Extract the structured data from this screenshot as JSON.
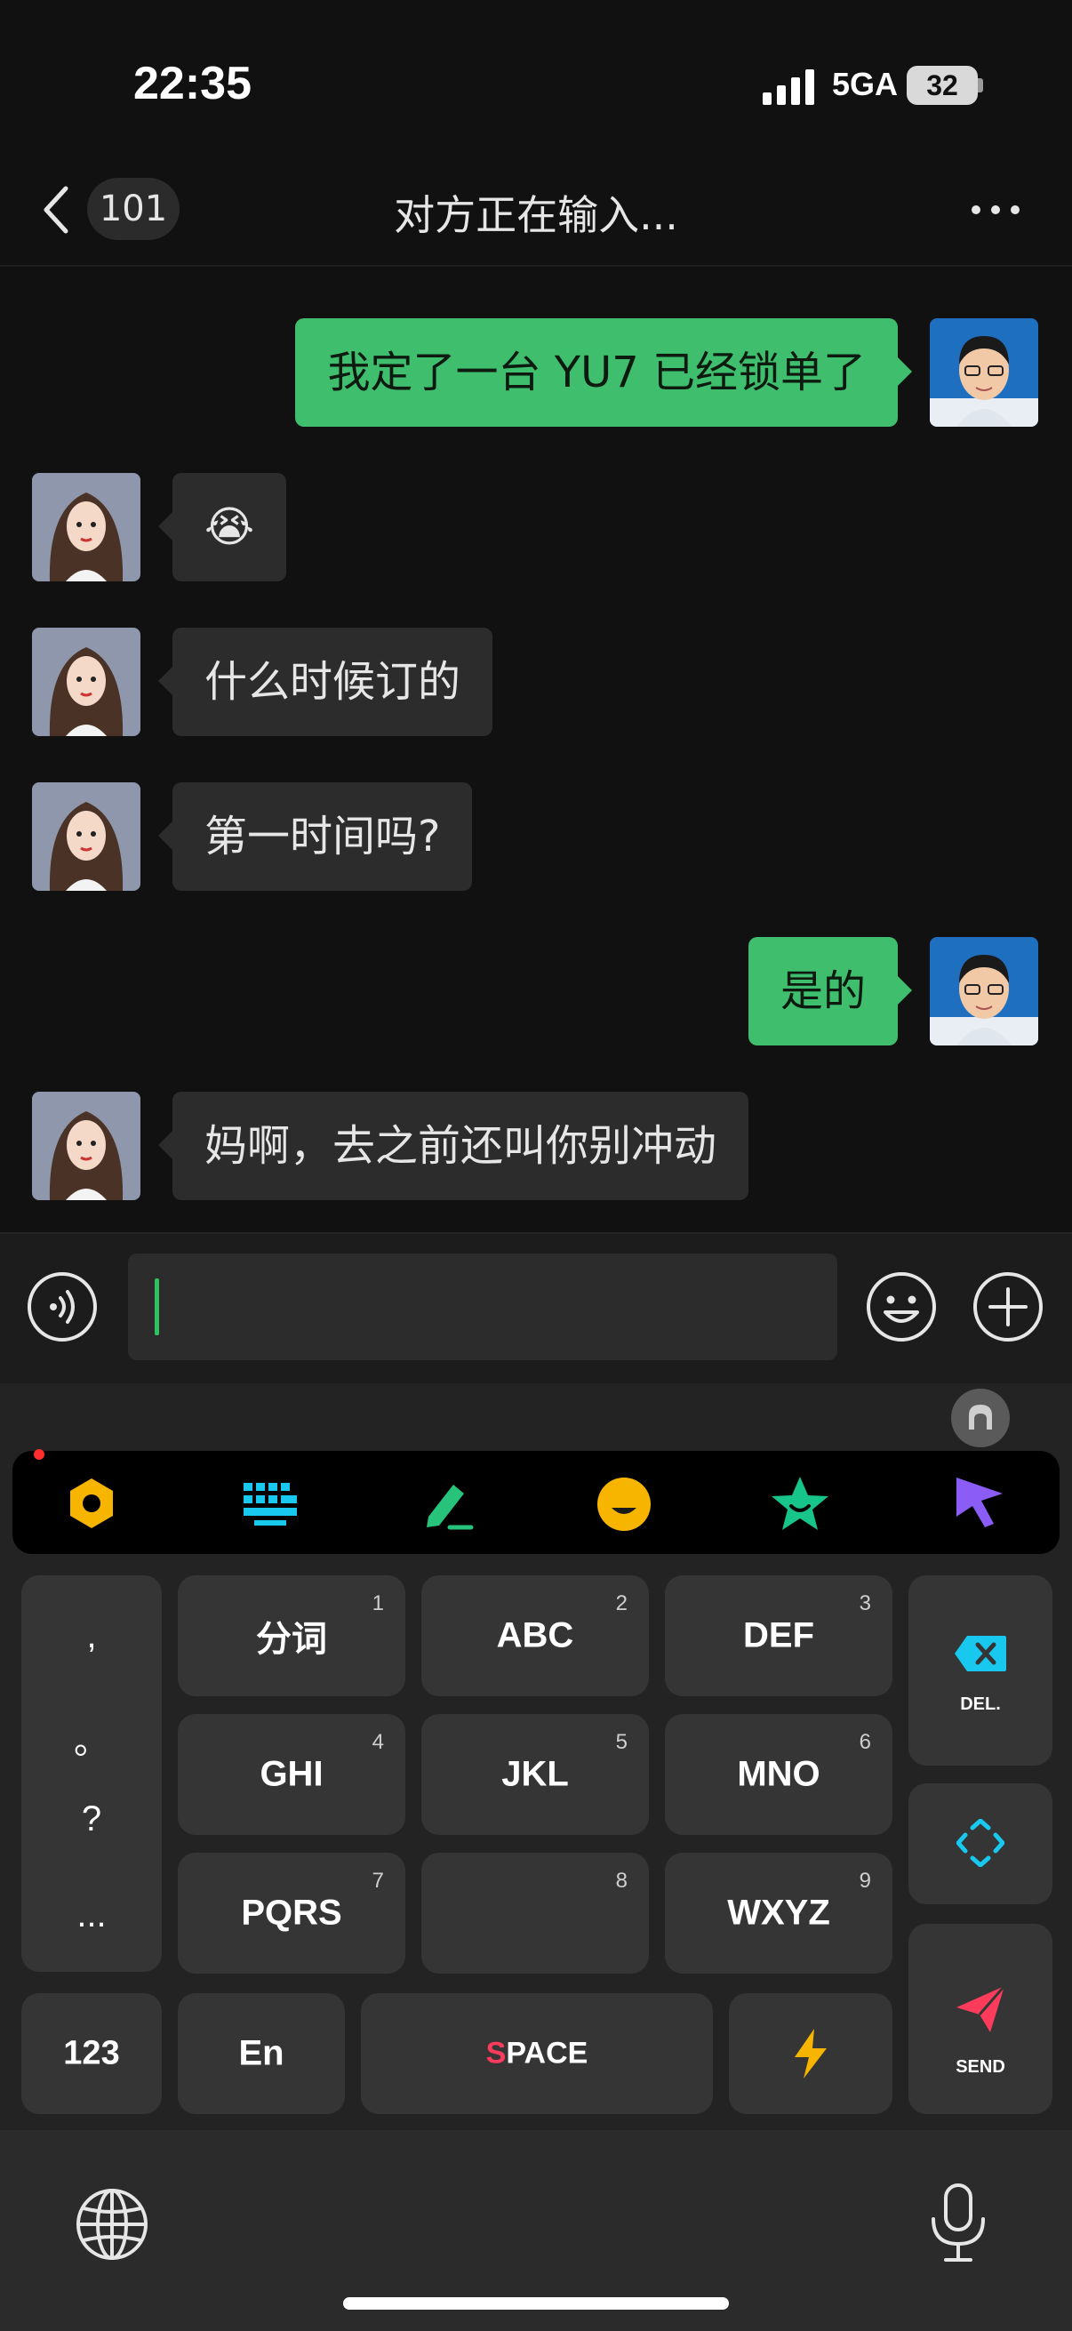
{
  "status_bar": {
    "time": "22:35",
    "network": "5GA",
    "battery": "32"
  },
  "nav": {
    "unread_count": "101",
    "title": "对方正在输入..."
  },
  "messages": [
    {
      "from": "me",
      "text": "我定了一台 YU7 已经锁单了"
    },
    {
      "from": "other",
      "text": "😭"
    },
    {
      "from": "other",
      "text": "什么时候订的"
    },
    {
      "from": "other",
      "text": "第一时间吗?"
    },
    {
      "from": "me",
      "text": "是的"
    },
    {
      "from": "other",
      "text": "妈啊，去之前还叫你别冲动"
    }
  ],
  "input": {
    "value": ""
  },
  "keyboard": {
    "punct": [
      ",",
      "。",
      "?",
      "..."
    ],
    "keys": [
      {
        "label": "分词",
        "num": "1"
      },
      {
        "label": "ABC",
        "num": "2"
      },
      {
        "label": "DEF",
        "num": "3"
      },
      {
        "label": "GHI",
        "num": "4"
      },
      {
        "label": "JKL",
        "num": "5"
      },
      {
        "label": "MNO",
        "num": "6"
      },
      {
        "label": "PQRS",
        "num": "7"
      },
      {
        "label": "",
        "num": "8"
      },
      {
        "label": "WXYZ",
        "num": "9"
      }
    ],
    "del_label": "DEL.",
    "send_label": "SEND",
    "num_label": "123",
    "lang_label": "En",
    "space_first": "S",
    "space_rest": "PACE"
  },
  "colors": {
    "accent_green": "#3fbf6e",
    "space_s": "#ff3b5c",
    "icon_cyan": "#18c8ef",
    "icon_yellow": "#f7b500"
  }
}
